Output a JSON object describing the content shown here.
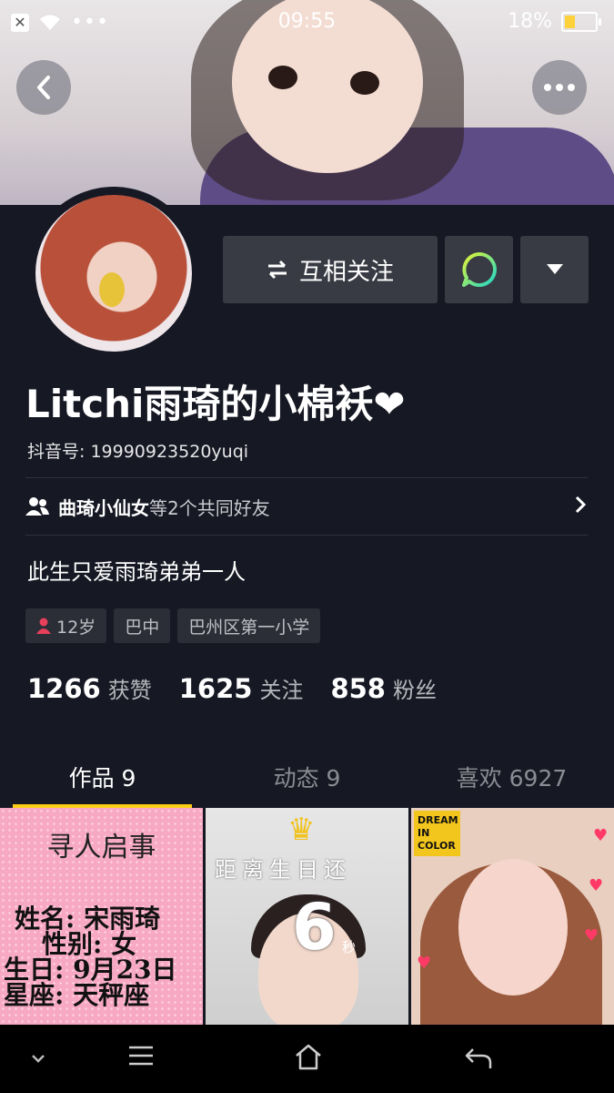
{
  "status_bar": {
    "time": "09:55",
    "battery": "18%"
  },
  "profile": {
    "name": "Litchi雨琦的小棉袄❤",
    "douyin_id": "抖音号: 19990923520yuqi",
    "bio": "此生只爱雨琦弟弟一人"
  },
  "actions": {
    "follow_label": "互相关注"
  },
  "friends": {
    "friend_name": "曲琦小仙女",
    "suffix": "等2个共同好友"
  },
  "tags": {
    "age": "12岁",
    "location": "巴中",
    "school": "巴州区第一小学"
  },
  "stats": {
    "likes_count": "1266",
    "likes_label": "获赞",
    "following_count": "1625",
    "following_label": "关注",
    "fans_count": "858",
    "fans_label": "粉丝"
  },
  "tabs": [
    {
      "label": "作品 9"
    },
    {
      "label": "动态 9"
    },
    {
      "label": "喜欢 6927"
    }
  ],
  "grid": {
    "post1": {
      "title": "寻人启事",
      "lines": [
        "姓名: 宋雨琦",
        "性别: 女",
        "生日: 9月23日",
        "星座: 天秤座"
      ]
    },
    "post2": {
      "header": "距离生日还",
      "count": "6",
      "unit": "秒"
    },
    "post3": {
      "badge_line1": "DREAM",
      "badge_line2": "IN COLOR"
    }
  },
  "colors": {
    "background": "#161823",
    "button": "#393b44",
    "tab_indicator": "#face15",
    "age_icon": "#e8405a"
  }
}
